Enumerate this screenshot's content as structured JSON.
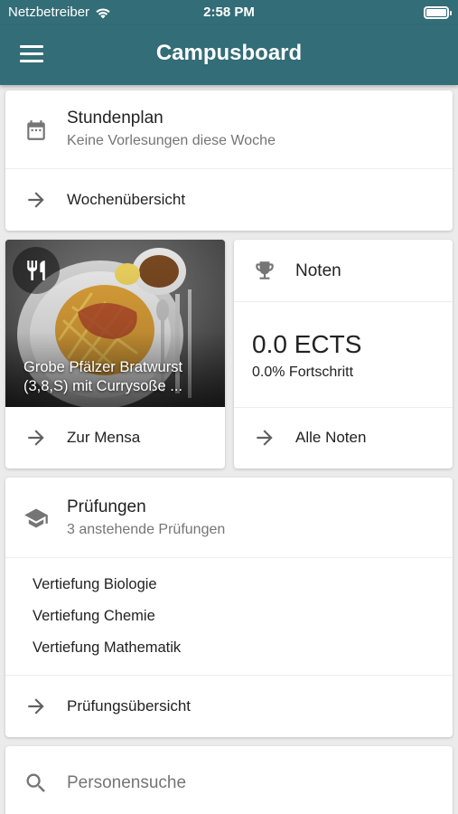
{
  "status_bar": {
    "carrier": "Netzbetreiber",
    "time": "2:58 PM"
  },
  "app_bar": {
    "title": "Campusboard"
  },
  "schedule": {
    "title": "Stundenplan",
    "subtitle": "Keine Vorlesungen diese Woche",
    "action": "Wochenübersicht"
  },
  "mensa": {
    "dish_line1": "Grobe Pfälzer Bratwurst",
    "dish_line2": "(3,8,S) mit Currysoße ...",
    "action": "Zur Mensa"
  },
  "grades": {
    "title": "Noten",
    "ects": "0.0 ECTS",
    "progress": "0.0% Fortschritt",
    "action": "Alle Noten"
  },
  "exams": {
    "title": "Prüfungen",
    "subtitle": "3 anstehende Prüfungen",
    "items": [
      "Vertiefung Biologie",
      "Vertiefung Chemie",
      "Vertiefung Mathematik"
    ],
    "action": "Prüfungsübersicht"
  },
  "search": {
    "placeholder": "Personensuche"
  },
  "colors": {
    "primary": "#336d77",
    "background": "#ebebeb",
    "card": "#ffffff"
  },
  "icons": [
    "wifi-icon",
    "battery-icon",
    "menu-icon",
    "calendar-icon",
    "arrow-right-icon",
    "cutlery-icon",
    "trophy-icon",
    "graduation-cap-icon",
    "search-icon"
  ]
}
